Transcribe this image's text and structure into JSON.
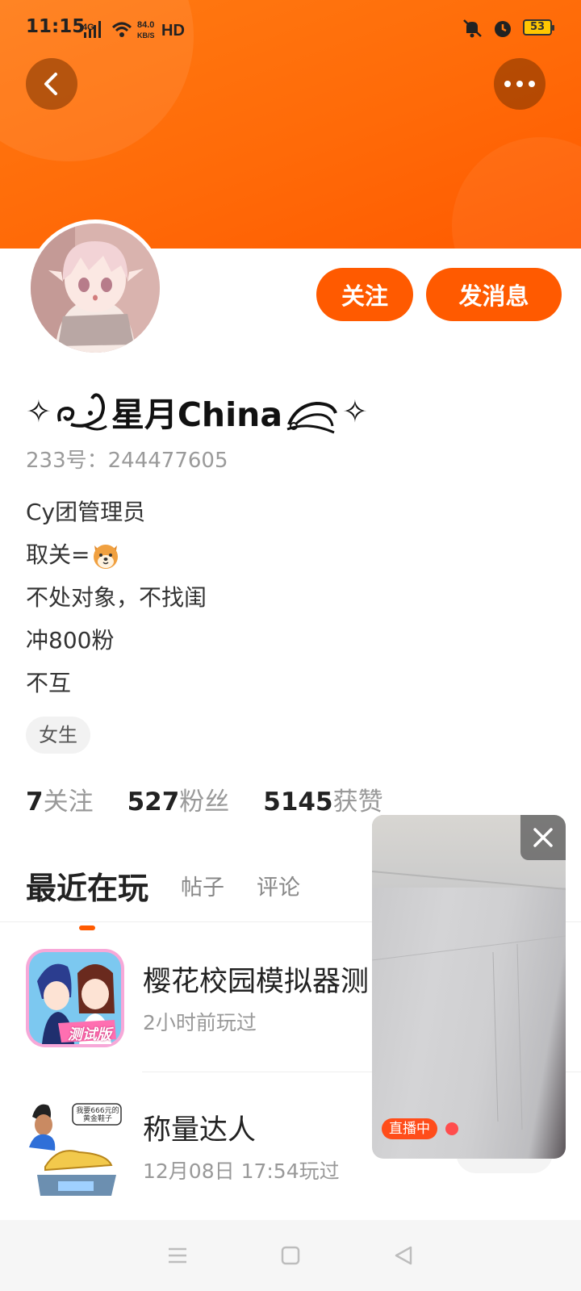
{
  "status_bar": {
    "time": "11:15",
    "network": "4G",
    "speed_value": "84.0",
    "speed_unit": "KB/S",
    "hd": "HD",
    "battery": "53"
  },
  "profile": {
    "username_left_glyph": "✧",
    "username": "星月China",
    "username_right_glyph": "✧",
    "uid_label": "233号：",
    "uid_value": "244477605",
    "bio_lines": [
      "Cy团管理员",
      "取关=",
      "不处对象，不找闺",
      "冲800粉",
      "不互"
    ],
    "gender_tag": "女生",
    "follow_label": "关注",
    "message_label": "发消息",
    "stats": [
      {
        "value": "7",
        "label": "关注"
      },
      {
        "value": "527",
        "label": "粉丝"
      },
      {
        "value": "5145",
        "label": "获赞"
      }
    ]
  },
  "tabs": [
    {
      "label": "最近在玩",
      "active": true
    },
    {
      "label": "帖子",
      "active": false
    },
    {
      "label": "评论",
      "active": false
    }
  ],
  "recent_games": [
    {
      "title": "樱花校园模拟器测",
      "time": "2小时前玩过",
      "icon_badge": "测试版"
    },
    {
      "title": "称量达人",
      "time": "12月08日 17:54玩过",
      "icon_bubble": "我要666元的黄金鞋子"
    }
  ],
  "floating_player": {
    "live_badge": "直播中"
  },
  "colors": {
    "accent": "#ff5a00",
    "header": "#ff7a12"
  },
  "icons": {
    "back": "back-icon",
    "more": "more-icon",
    "close": "close-icon",
    "nav_menu": "menu-icon",
    "nav_home": "home-square-icon",
    "nav_back": "back-triangle-icon"
  }
}
